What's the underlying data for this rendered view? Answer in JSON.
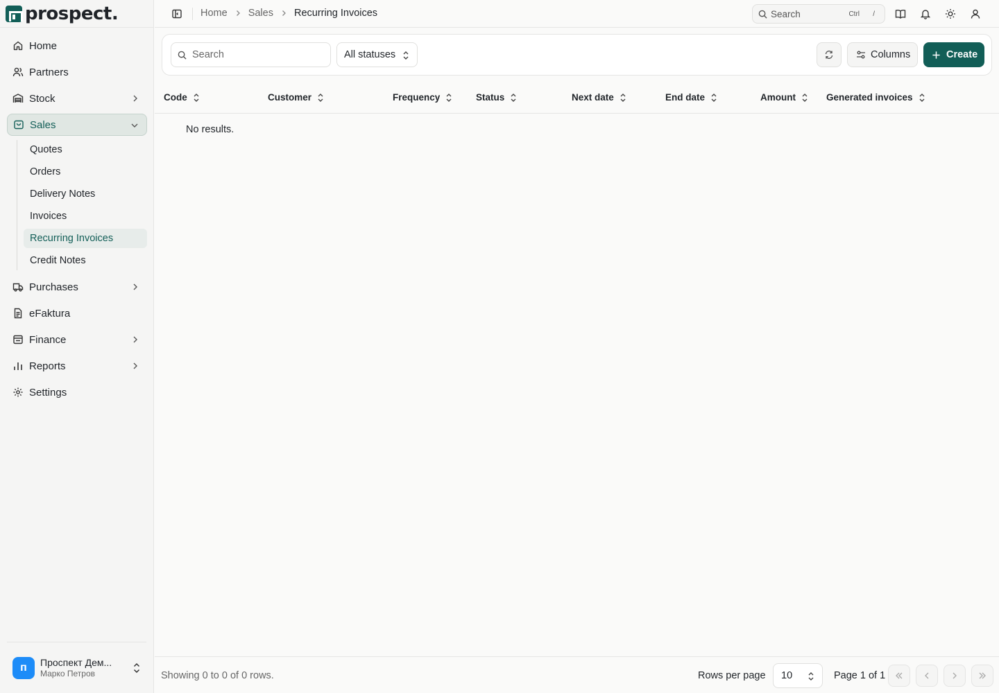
{
  "app": {
    "logo_text": "prospect."
  },
  "sidebar": {
    "items": [
      {
        "label": "Home",
        "icon": "home-icon"
      },
      {
        "label": "Partners",
        "icon": "users-icon",
        "expandable": false
      },
      {
        "label": "Stock",
        "icon": "warehouse-icon",
        "expandable": true
      },
      {
        "label": "Sales",
        "icon": "shopping-bag-icon",
        "expandable": true,
        "expanded": true,
        "active": true
      },
      {
        "label": "Purchases",
        "icon": "truck-icon",
        "expandable": true
      },
      {
        "label": "eFaktura",
        "icon": "document-icon"
      },
      {
        "label": "Finance",
        "icon": "wallet-icon",
        "expandable": true
      },
      {
        "label": "Reports",
        "icon": "bar-chart-icon",
        "expandable": true
      },
      {
        "label": "Settings",
        "icon": "gear-icon"
      }
    ],
    "sales_sub": [
      "Quotes",
      "Orders",
      "Delivery Notes",
      "Invoices",
      "Recurring Invoices",
      "Credit Notes"
    ],
    "active_sub": "Recurring Invoices",
    "account": {
      "initial": "п",
      "name": "Проспект Дем...",
      "user": "Марко Петров"
    }
  },
  "header": {
    "breadcrumbs": [
      "Home",
      "Sales",
      "Recurring Invoices"
    ],
    "search_label": "Search",
    "shortcut_ctrl": "Ctrl",
    "shortcut_key": "/"
  },
  "toolbar": {
    "search_placeholder": "Search",
    "status_filter": "All statuses",
    "columns_label": "Columns",
    "create_label": "Create"
  },
  "table": {
    "columns": [
      "Code",
      "Customer",
      "Frequency",
      "Status",
      "Next date",
      "End date",
      "Amount",
      "Generated invoices"
    ],
    "empty_text": "No results."
  },
  "footer": {
    "showing": "Showing 0 to 0 of 0 rows.",
    "rows_per_page_label": "Rows per page",
    "rows_per_page": "10",
    "page_info": "Page 1 of 1"
  },
  "colors": {
    "accent": "#125e57",
    "avatar": "#1d8cf8"
  }
}
